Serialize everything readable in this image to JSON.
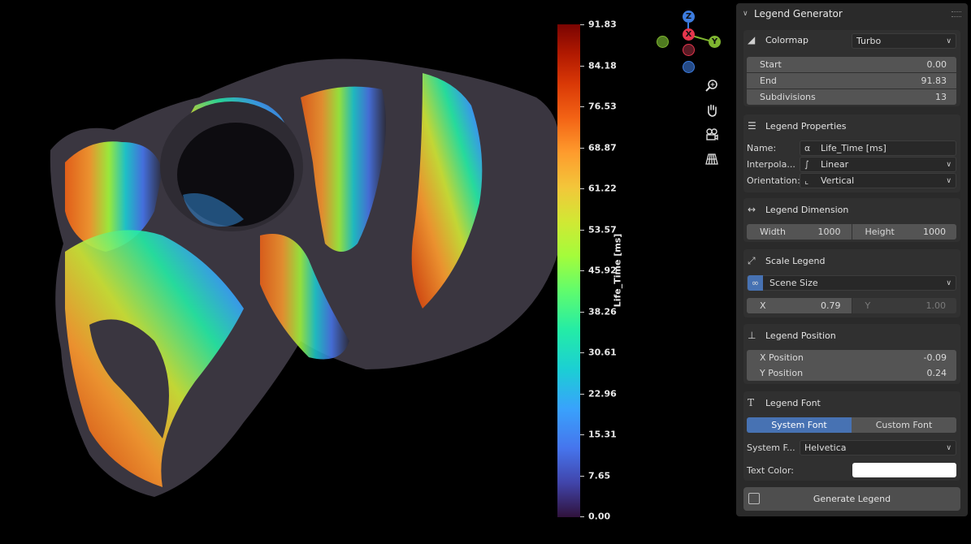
{
  "viewport": {
    "colorbar": {
      "title": "Life_Time [ms]",
      "tick_labels": [
        "91.83",
        "84.18",
        "76.53",
        "68.87",
        "61.22",
        "53.57",
        "45.92",
        "38.26",
        "30.61",
        "22.96",
        "15.31",
        "7.65",
        "0.00"
      ]
    },
    "gizmo": {
      "z": "Z",
      "x": "X",
      "y": "Y",
      "colors": {
        "x": "#e5364d",
        "y": "#7fb530",
        "z": "#3c7ce0"
      }
    },
    "nav_icons": [
      "zoom-icon",
      "pan-hand-icon",
      "camera-icon",
      "grid-perspective-icon"
    ]
  },
  "panel": {
    "title": "Legend Generator",
    "colormap": {
      "label": "Colormap",
      "value": "Turbo",
      "start_label": "Start",
      "start": "0.00",
      "end_label": "End",
      "end": "91.83",
      "subdiv_label": "Subdivisions",
      "subdivisions": "13"
    },
    "properties": {
      "title": "Legend Properties",
      "name_label": "Name:",
      "name_value": "Life_Time [ms]",
      "interp_label": "Interpola...",
      "interp_value": "Linear",
      "orient_label": "Orientation:",
      "orient_value": "Vertical"
    },
    "dimension": {
      "title": "Legend Dimension",
      "width_label": "Width",
      "width": "1000",
      "height_label": "Height",
      "height": "1000"
    },
    "scale": {
      "title": "Scale Legend",
      "mode": "Scene Size",
      "x_label": "X",
      "x": "0.79",
      "y_label": "Y",
      "y": "1.00"
    },
    "position": {
      "title": "Legend Position",
      "x_label": "X Position",
      "x": "-0.09",
      "y_label": "Y Position",
      "y": "0.24"
    },
    "font": {
      "title": "Legend Font",
      "system_tab": "System Font",
      "custom_tab": "Custom Font",
      "system_label": "System F...",
      "system_value": "Helvetica",
      "color_label": "Text Color:",
      "text_color": "#ffffff"
    },
    "generate_label": "Generate Legend"
  }
}
